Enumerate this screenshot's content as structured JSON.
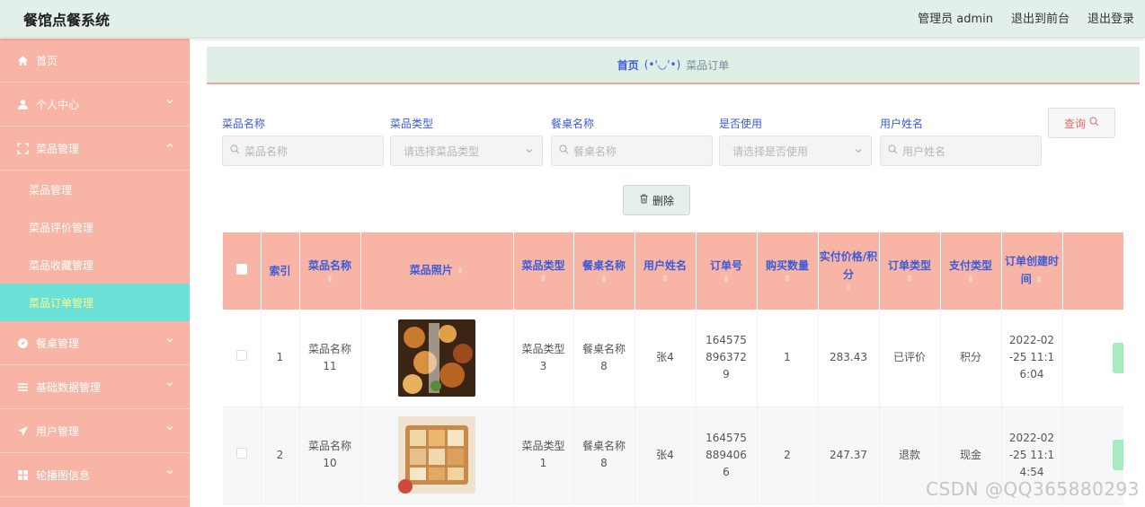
{
  "header": {
    "title": "餐馆点餐系统",
    "admin_label": "管理员 admin",
    "to_front": "退出到前台",
    "logout": "退出登录"
  },
  "sidebar": {
    "items": [
      {
        "label": "首页",
        "icon": "home-icon"
      },
      {
        "label": "个人中心",
        "icon": "user-icon"
      },
      {
        "label": "菜品管理",
        "icon": "expand-icon"
      },
      {
        "label": "餐桌管理",
        "icon": "compass-icon"
      },
      {
        "label": "基础数据管理",
        "icon": "list-icon"
      },
      {
        "label": "用户管理",
        "icon": "send-icon"
      },
      {
        "label": "轮播图信息",
        "icon": "grid-icon"
      }
    ],
    "sub_items": [
      "菜品管理",
      "菜品评价管理",
      "菜品收藏管理",
      "菜品订单管理"
    ],
    "active_color": "#6be0d6"
  },
  "breadcrumb": {
    "home": "首页",
    "face": "(•'◡'•)",
    "current": "菜品订单"
  },
  "filters": [
    {
      "label": "菜品名称",
      "placeholder": "菜品名称",
      "type": "input"
    },
    {
      "label": "菜品类型",
      "placeholder": "请选择菜品类型",
      "type": "select"
    },
    {
      "label": "餐桌名称",
      "placeholder": "餐桌名称",
      "type": "input"
    },
    {
      "label": "是否使用",
      "placeholder": "请选择是否使用",
      "type": "select"
    },
    {
      "label": "用户姓名",
      "placeholder": "用户姓名",
      "type": "input"
    }
  ],
  "buttons": {
    "query": "查询",
    "delete": "删除"
  },
  "table": {
    "headers": [
      "索引",
      "菜品名称",
      "菜品照片",
      "菜品类型",
      "餐桌名称",
      "用户姓名",
      "订单号",
      "购买数量",
      "实付价格/积分",
      "订单类型",
      "支付类型",
      "订单创建时间"
    ],
    "rows": [
      {
        "index": "1",
        "name": "菜品名称11",
        "type": "菜品类型3",
        "table": "餐桌名称8",
        "user": "张4",
        "order_no": "1645758963729",
        "qty": "1",
        "price": "283.43",
        "order_type": "已评价",
        "pay_type": "积分",
        "created": "2022-02-25 11:16:04"
      },
      {
        "index": "2",
        "name": "菜品名称10",
        "type": "菜品类型1",
        "table": "餐桌名称8",
        "user": "张4",
        "order_no": "1645758894066",
        "qty": "2",
        "price": "247.37",
        "order_type": "退款",
        "pay_type": "现金",
        "created": "2022-02-25 11:14:54"
      }
    ]
  },
  "watermark": "CSDN @QQ365880293",
  "colors": {
    "header_bg": "#e3f0ea",
    "sidebar_bg": "#f8b5a5",
    "accent_blue": "#3b5bd9",
    "active_item": "#6be0d6",
    "active_text": "#fffb8c"
  }
}
